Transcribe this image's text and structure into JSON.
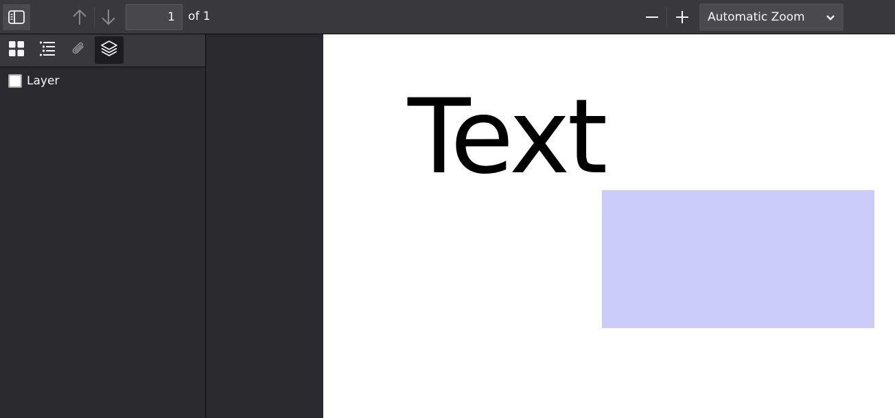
{
  "toolbar": {
    "page_number": "1",
    "page_count": "of 1",
    "zoom_label": "Automatic Zoom"
  },
  "icons": {
    "sidebar_toggle": "sidebar-toggle-icon",
    "previous_page": "arrow-up-icon",
    "next_page": "arrow-down-icon",
    "zoom_out": "minus-icon",
    "zoom_in": "plus-icon",
    "zoom_dropdown": "chevron-down-icon",
    "thumbnails": "thumbnails-grid-icon",
    "outline": "outline-list-icon",
    "attachments": "paperclip-icon",
    "layers": "layers-icon"
  },
  "sidebar": {
    "layers": [
      {
        "label": "Layer",
        "checked": false
      }
    ]
  },
  "document": {
    "text": "Text",
    "rect_color": "#ccccfa"
  }
}
